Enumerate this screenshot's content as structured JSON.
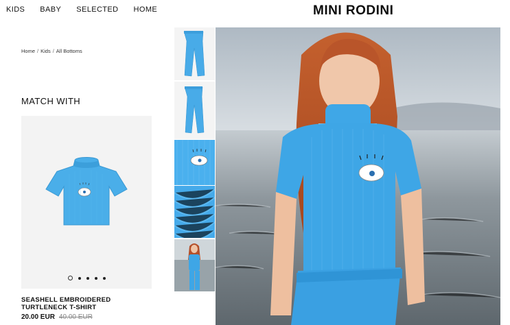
{
  "nav": {
    "items": [
      "KIDS",
      "BABY",
      "SELECTED",
      "HOME"
    ]
  },
  "brand": "MINI RODINI",
  "breadcrumb": [
    "Home",
    "Kids",
    "All Bottoms"
  ],
  "match": {
    "title": "MATCH WITH",
    "product_name": "SEASHELL EMBROIDERED TURTLENECK T-SHIRT",
    "price": "20.00 EUR",
    "old_price": "40.00 EUR",
    "carousel_dots": 5,
    "active_dot": 1
  },
  "colors": {
    "product_blue": "#3ea6e6",
    "card_bg": "#f3f3f3"
  },
  "thumbnails": [
    "pants-front",
    "pants-back",
    "embroidery-detail",
    "fabric-detail",
    "model-full"
  ],
  "icons": [
    "seashell-embroidery-icon"
  ]
}
